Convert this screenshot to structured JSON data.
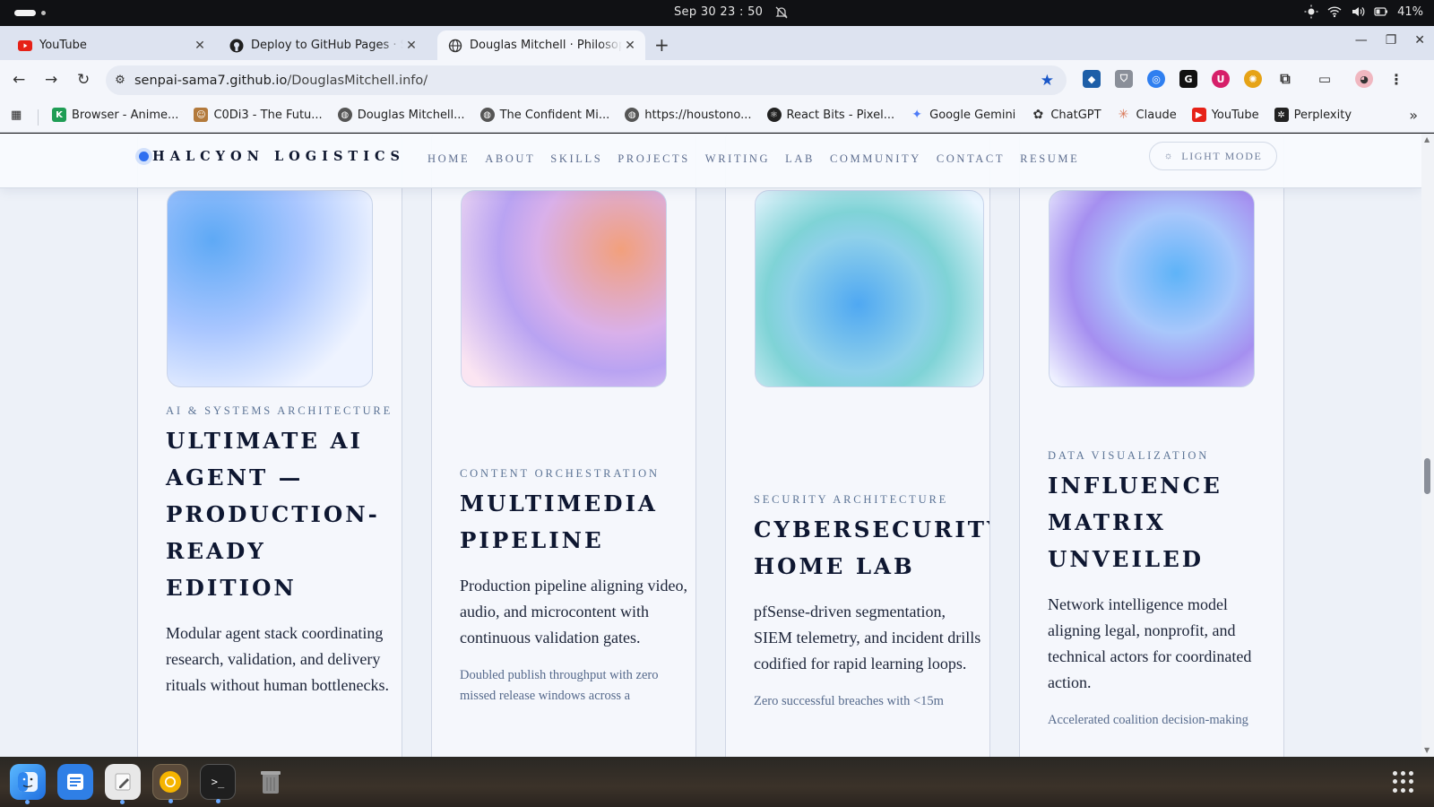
{
  "os": {
    "clock": "Sep 30  23 : 50",
    "battery": "41%"
  },
  "browser": {
    "tabs": [
      {
        "title": "YouTube",
        "icon": "youtube-icon"
      },
      {
        "title": "Deploy to GitHub Pages · Se",
        "icon": "github-icon"
      },
      {
        "title": "Douglas Mitchell · Philosop",
        "icon": "globe-icon"
      }
    ],
    "url_host": "senpai-sama7.github.io",
    "url_path": "/DouglasMitchell.info/",
    "bookmarks": [
      {
        "label": "Browser - Anime...",
        "icon": "k-icon",
        "color": "#1f9d55"
      },
      {
        "label": "C0Di3 - The Futu...",
        "icon": "person-icon",
        "color": "#b37a3c"
      },
      {
        "label": "Douglas Mitchell...",
        "icon": "globe-icon",
        "color": "#555555"
      },
      {
        "label": "The Confident Mi...",
        "icon": "globe-icon",
        "color": "#555555"
      },
      {
        "label": "https://houstono...",
        "icon": "globe-icon",
        "color": "#555555"
      },
      {
        "label": "React Bits - Pixel...",
        "icon": "reactbits-icon",
        "color": "#222222"
      },
      {
        "label": "Google Gemini",
        "icon": "gemini-icon",
        "color": "#4f7cf7"
      },
      {
        "label": "ChatGPT",
        "icon": "chatgpt-icon",
        "color": "#333333"
      },
      {
        "label": "Claude",
        "icon": "claude-icon",
        "color": "#d97757"
      },
      {
        "label": "YouTube",
        "icon": "youtube-icon",
        "color": "#e62117"
      },
      {
        "label": "Perplexity",
        "icon": "perplexity-icon",
        "color": "#222222"
      }
    ]
  },
  "site": {
    "brand": "HALCYON LOGISTICS",
    "menu": [
      "HOME",
      "ABOUT",
      "SKILLS",
      "PROJECTS",
      "WRITING",
      "LAB",
      "COMMUNITY",
      "CONTACT",
      "RESUME"
    ],
    "mode_button": "LIGHT MODE",
    "cards": [
      {
        "category": "AI & SYSTEMS ARCHITECTURE",
        "title": "ULTIMATE AI AGENT — PRODUCTION-READY EDITION",
        "description": "Modular agent stack coordinating research, validation, and delivery rituals without human bottlenecks.",
        "impact": "",
        "gradient": [
          "#5ea9f5",
          "#a9c6ff",
          "#eef3ff"
        ]
      },
      {
        "category": "CONTENT ORCHESTRATION",
        "title": "MULTIMEDIA PIPELINE",
        "description": "Production pipeline aligning video, audio, and microcontent with continuous validation gates.",
        "impact": "Doubled publish throughput with zero missed release windows across a",
        "gradient": [
          "#f2a07c",
          "#b9a3f2",
          "#fbe5f2"
        ]
      },
      {
        "category": "SECURITY ARCHITECTURE",
        "title": "CYBERSECURITY HOME LAB",
        "description": "pfSense-driven segmentation, SIEM telemetry, and incident drills codified for rapid learning loops.",
        "impact": "Zero successful breaches with <15m",
        "gradient": [
          "#4fa8f2",
          "#7fd3d6",
          "#e9f5ff"
        ]
      },
      {
        "category": "DATA VISUALIZATION",
        "title": "INFLUENCE MATRIX UNVEILED",
        "description": "Network intelligence model aligning legal, nonprofit, and technical actors for coordinated action.",
        "impact": "Accelerated coalition decision-making",
        "gradient": [
          "#5eb3f8",
          "#a58ff0",
          "#eef0ff"
        ]
      }
    ]
  },
  "taskbar": {
    "apps": [
      "finder-icon",
      "files-icon",
      "text-editor-icon",
      "chrome-icon",
      "terminal-icon",
      "trash-icon"
    ]
  }
}
